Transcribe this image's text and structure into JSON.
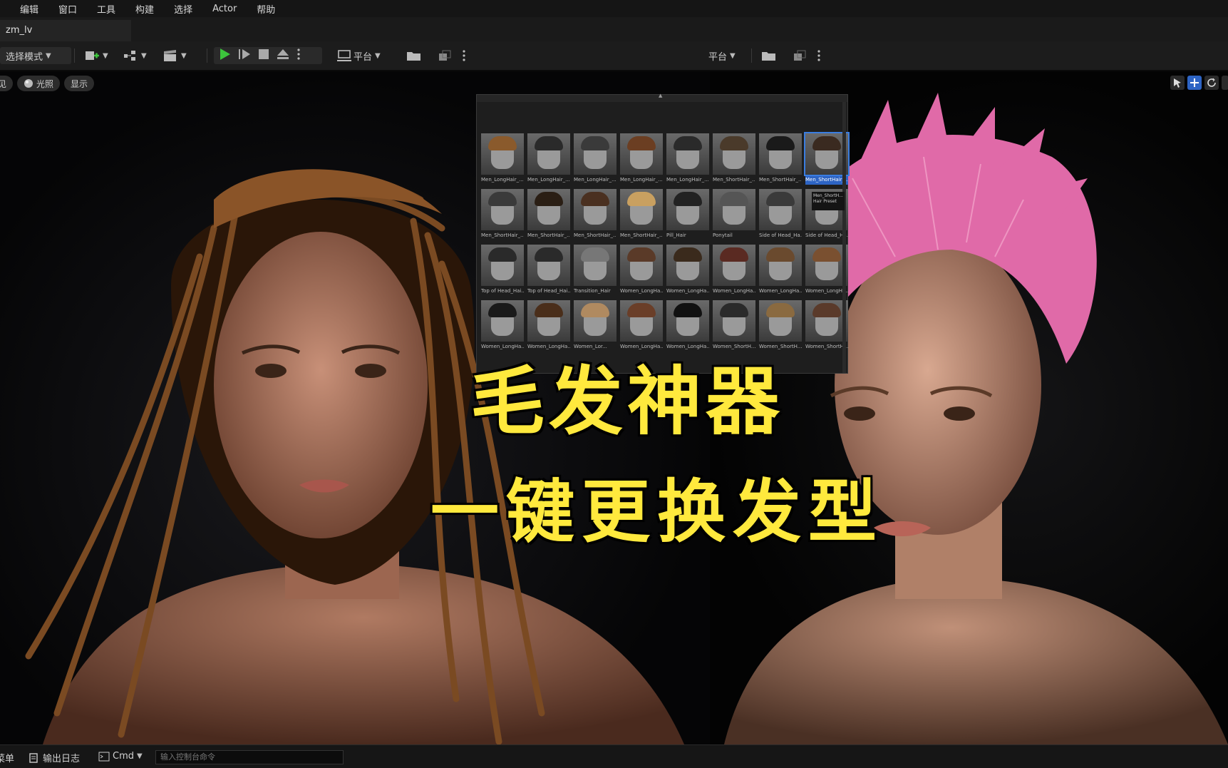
{
  "menu": {
    "items": [
      "编辑",
      "窗口",
      "工具",
      "构建",
      "选择",
      "Actor",
      "帮助"
    ]
  },
  "tabs": {
    "level_tab": "zm_lv"
  },
  "toolbar": {
    "mode_label": "选择模式",
    "platform_label": "平台",
    "platform_label_right": "平台"
  },
  "viewport": {
    "left_pill_partial": "见",
    "lighting_label": "光照",
    "show_label": "显示"
  },
  "hair_grid": {
    "items": [
      "Men_LongHair_...",
      "Men_LongHair_...",
      "Men_LongHair_...",
      "Men_LongHair_...",
      "Men_LongHair_...",
      "Men_ShortHair_...",
      "Men_ShortHair_...",
      "Men_ShortHair_...",
      "Men_ShortHair_...",
      "Men_ShortHair_...",
      "Men_ShortHair_...",
      "Men_ShortHair_...",
      "Pill_Hair",
      "Ponytail",
      "Side of Head_Ha...",
      "Side of Head_Ha...",
      "Top of Head_Hai...",
      "Top of Head_Hai...",
      "Transition_Hair",
      "Women_LongHa...",
      "Women_LongHa...",
      "Women_LongHa...",
      "Women_LongHa...",
      "Women_LongHa...",
      "Women_LongHa...",
      "Women_LongHa...",
      "Women_Lor...",
      "Women_LongHa...",
      "Women_LongHa...",
      "Women_ShortH...",
      "Women_ShortH...",
      "Women_ShortH..."
    ],
    "selected_index": 7,
    "tooltip": "Men_ShortH... Hair Preset"
  },
  "overlay": {
    "title": "毛发神器",
    "subtitle": "一键更换发型"
  },
  "statusbar": {
    "menu_partial": "菜单",
    "output_log": "输出日志",
    "cmd_label": "Cmd",
    "console_placeholder": "输入控制台命令"
  },
  "colors": {
    "accent_yellow": "#ffe93d",
    "play_green": "#3cc43c",
    "selection_blue": "#2d64c4",
    "pink_hair": "#e06aa8",
    "braid_brown": "#7a4a22"
  }
}
